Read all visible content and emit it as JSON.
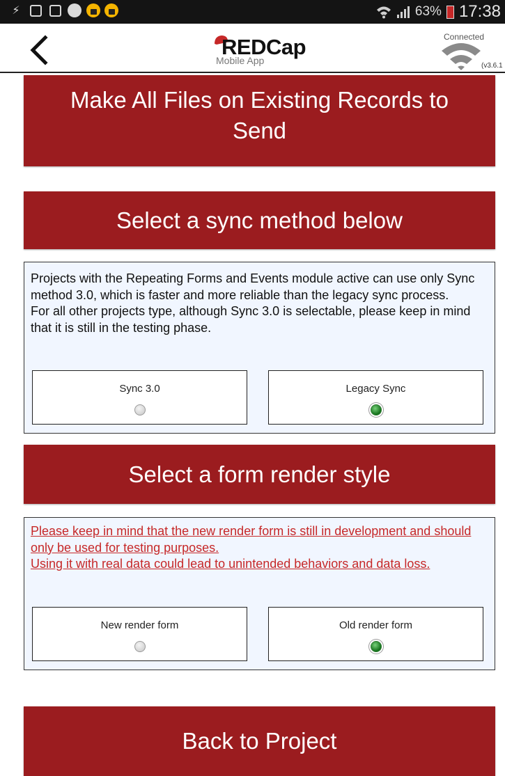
{
  "status_bar": {
    "left_icons": [
      "usb-icon",
      "keyboard-icon",
      "image-icon",
      "shield-s-icon",
      "lock-icon",
      "lock-icon"
    ],
    "battery_percent": "63%",
    "time": "17:38",
    "battery_level": 0.63
  },
  "header": {
    "logo_name": "REDCap",
    "logo_sub": "Mobile App",
    "connection_status": "Connected",
    "version": "(v3.6.1"
  },
  "buttons": {
    "make_files": "Make All Files on Existing Records to Send",
    "sync_method": "Select a sync method below",
    "render_style": "Select a form render style",
    "back": "Back to Project"
  },
  "sync_panel": {
    "line1": "Projects with the Repeating Forms and Events module active can use only Sync method 3.0, which is faster and more reliable than the legacy sync process.",
    "line2": "For all other projects type, although Sync 3.0 is selectable, please keep in mind that it is still in the testing phase.",
    "options": [
      {
        "label": "Sync 3.0",
        "selected": false
      },
      {
        "label": "Legacy Sync",
        "selected": true
      }
    ]
  },
  "render_panel": {
    "warning1": "Please keep in mind that the new render form is still in development and should only be used for testing purposes.",
    "warning2": "Using it with real data could lead to unintended behaviors and data loss.",
    "options": [
      {
        "label": "New render form",
        "selected": false
      },
      {
        "label": "Old render form",
        "selected": true
      }
    ]
  },
  "colors": {
    "accent": "#9b1c1f",
    "warning_text": "#c62828",
    "panel_bg": "#f1f6ff",
    "selected_radio": "#13701a"
  }
}
